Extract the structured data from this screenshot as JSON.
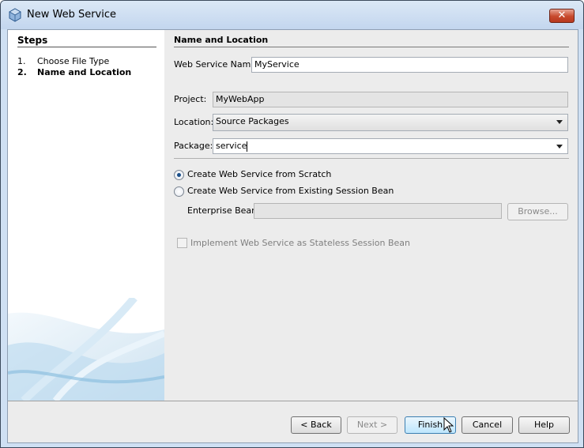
{
  "window": {
    "title": "New Web Service",
    "close_label": "✕"
  },
  "steps": {
    "title": "Steps",
    "items": [
      {
        "num": "1.",
        "label": "Choose File Type"
      },
      {
        "num": "2.",
        "label": "Name and Location"
      }
    ]
  },
  "form": {
    "section_title": "Name and Location",
    "service_name_label": "Web Service Name:",
    "service_name_value": "MyService",
    "project_label": "Project:",
    "project_value": "MyWebApp",
    "location_label": "Location:",
    "location_value": "Source Packages",
    "package_label": "Package:",
    "package_value": "service",
    "radio_scratch": "Create Web Service from Scratch",
    "radio_existing": "Create Web Service from Existing Session Bean",
    "enterprise_bean_label": "Enterprise Bean:",
    "browse_label": "Browse...",
    "stateless_label": "Implement Web Service as Stateless Session Bean"
  },
  "buttons": {
    "back": "< Back",
    "next": "Next >",
    "finish": "Finish",
    "cancel": "Cancel",
    "help": "Help"
  },
  "colors": {
    "accent": "#1b4f8a",
    "client_bg": "#ececec",
    "title_bg": "#cfe0f3"
  }
}
